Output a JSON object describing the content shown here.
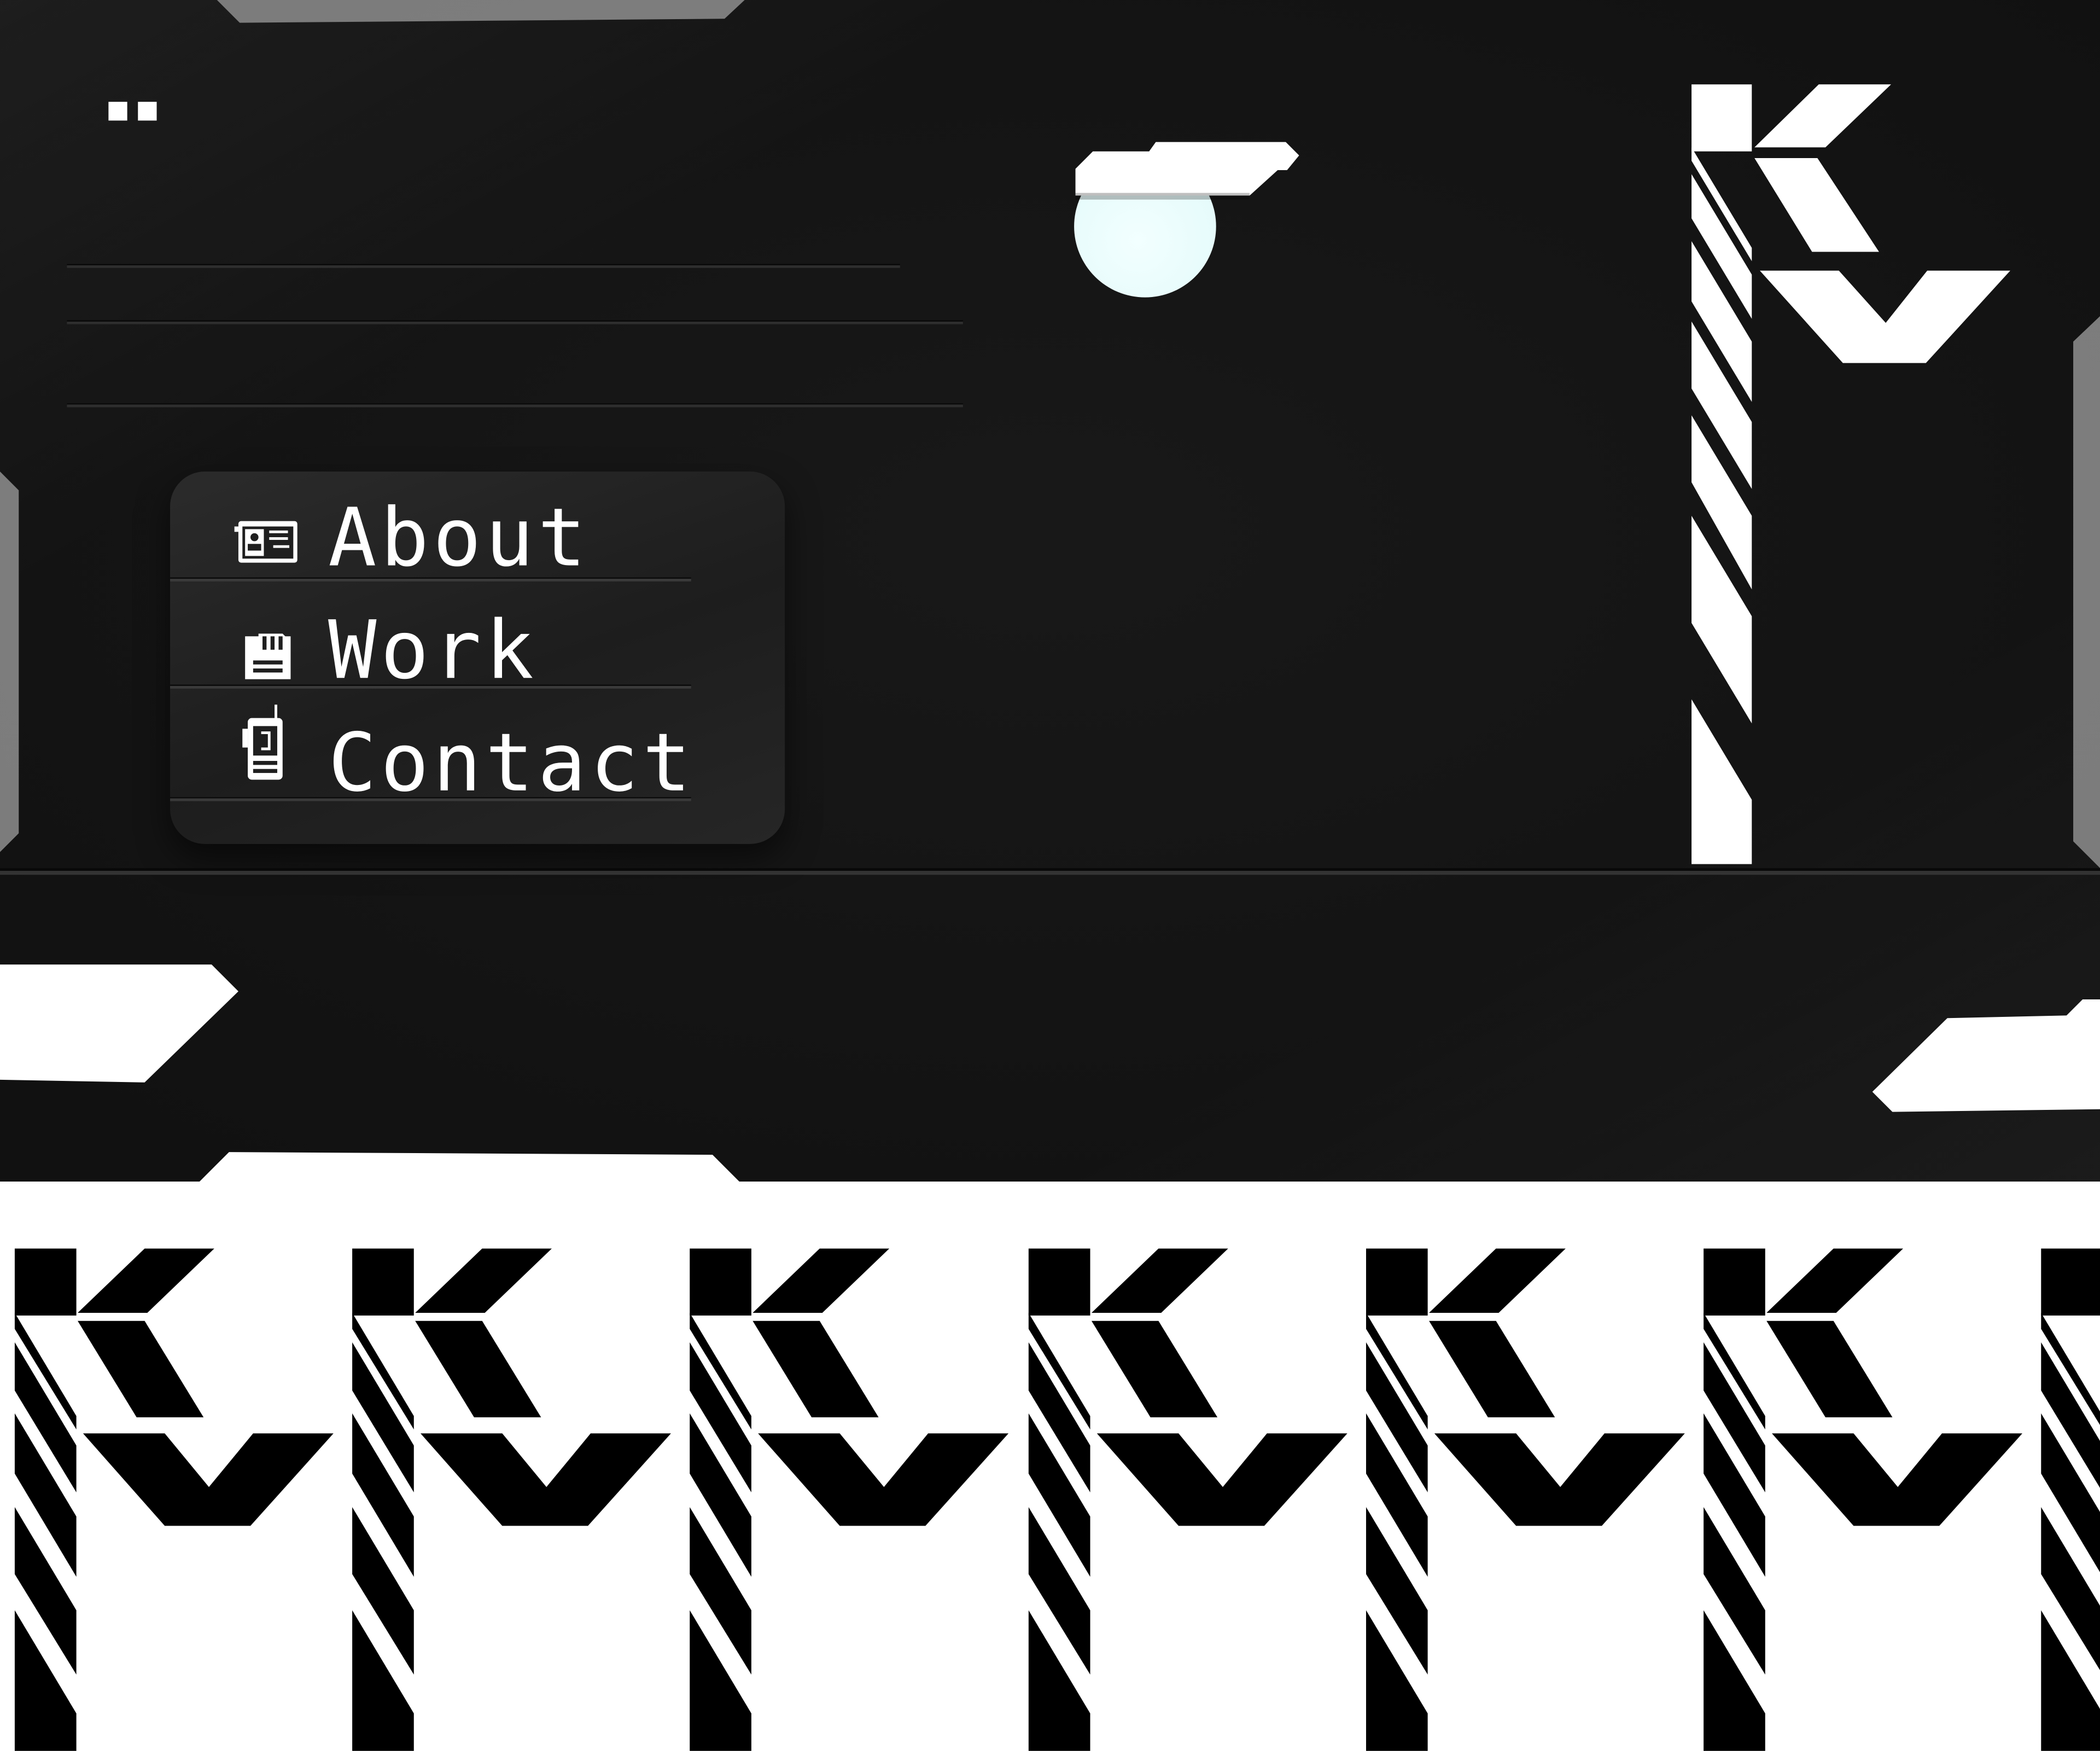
{
  "nav": {
    "items": [
      {
        "label": "About",
        "icon": "id-card-icon"
      },
      {
        "label": "Work",
        "icon": "sd-card-icon"
      },
      {
        "label": "Contact",
        "icon": "walkie-talkie-icon"
      }
    ]
  },
  "colors": {
    "panel": "#141414",
    "accent_orb": "#e6fbfb",
    "text": "#ffffff",
    "background": "#ffffff"
  },
  "logo": {
    "monogram": "KV"
  }
}
